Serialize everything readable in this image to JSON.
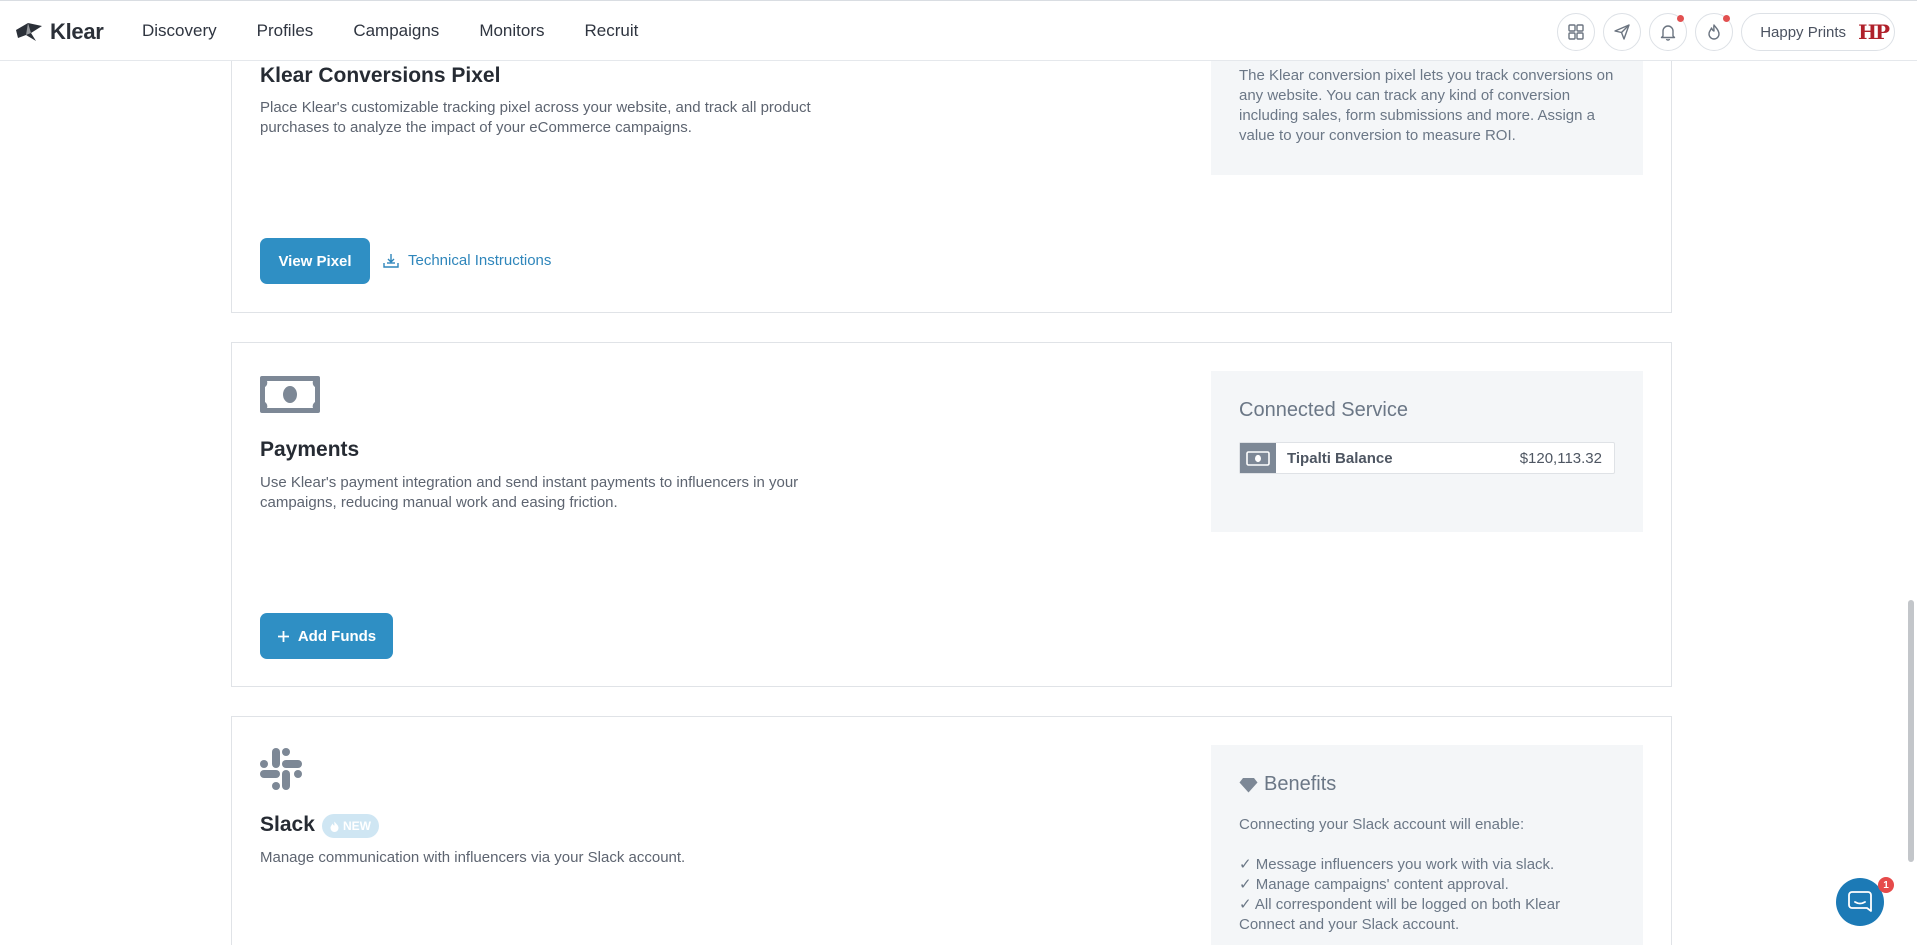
{
  "nav": {
    "logo": "Klear",
    "links": [
      "Discovery",
      "Profiles",
      "Campaigns",
      "Monitors",
      "Recruit"
    ],
    "account_name": "Happy Prints",
    "account_logo": "HP",
    "icons": [
      "grid-icon",
      "send-icon",
      "bell-icon",
      "fire-icon"
    ]
  },
  "pixel": {
    "title": "Klear Conversions Pixel",
    "description": "Place Klear's customizable tracking pixel across your website, and track all product purchases to analyze the impact of your eCommerce campaigns.",
    "info": "The Klear conversion pixel lets you track conversions on any website. You can track any kind of conversion including sales, form submissions and more. Assign a value to your conversion to measure ROI.",
    "button": "View Pixel",
    "link": "Technical Instructions"
  },
  "payments": {
    "title": "Payments",
    "description": "Use Klear's payment integration and send instant payments to influencers in your campaigns, reducing manual work and easing friction.",
    "service_heading": "Connected Service",
    "service_name": "Tipalti Balance",
    "service_amount": "$120,113.32",
    "button": "Add Funds"
  },
  "slack": {
    "title": "Slack",
    "badge": "NEW",
    "description": "Manage communication with influencers via your Slack account.",
    "benefits_heading": "Benefits",
    "benefits_intro": "Connecting your Slack account will enable:",
    "benefits": [
      "Message influencers you work with via slack.",
      "Manage campaigns' content approval.",
      "All correspondent will be logged on both Klear Connect and your Slack account."
    ]
  },
  "chat": {
    "badge_count": "1"
  },
  "colors": {
    "accent": "#2f8fc4",
    "link": "#2f86bb",
    "side_box": "#f4f6f8",
    "notification": "#e25050"
  }
}
